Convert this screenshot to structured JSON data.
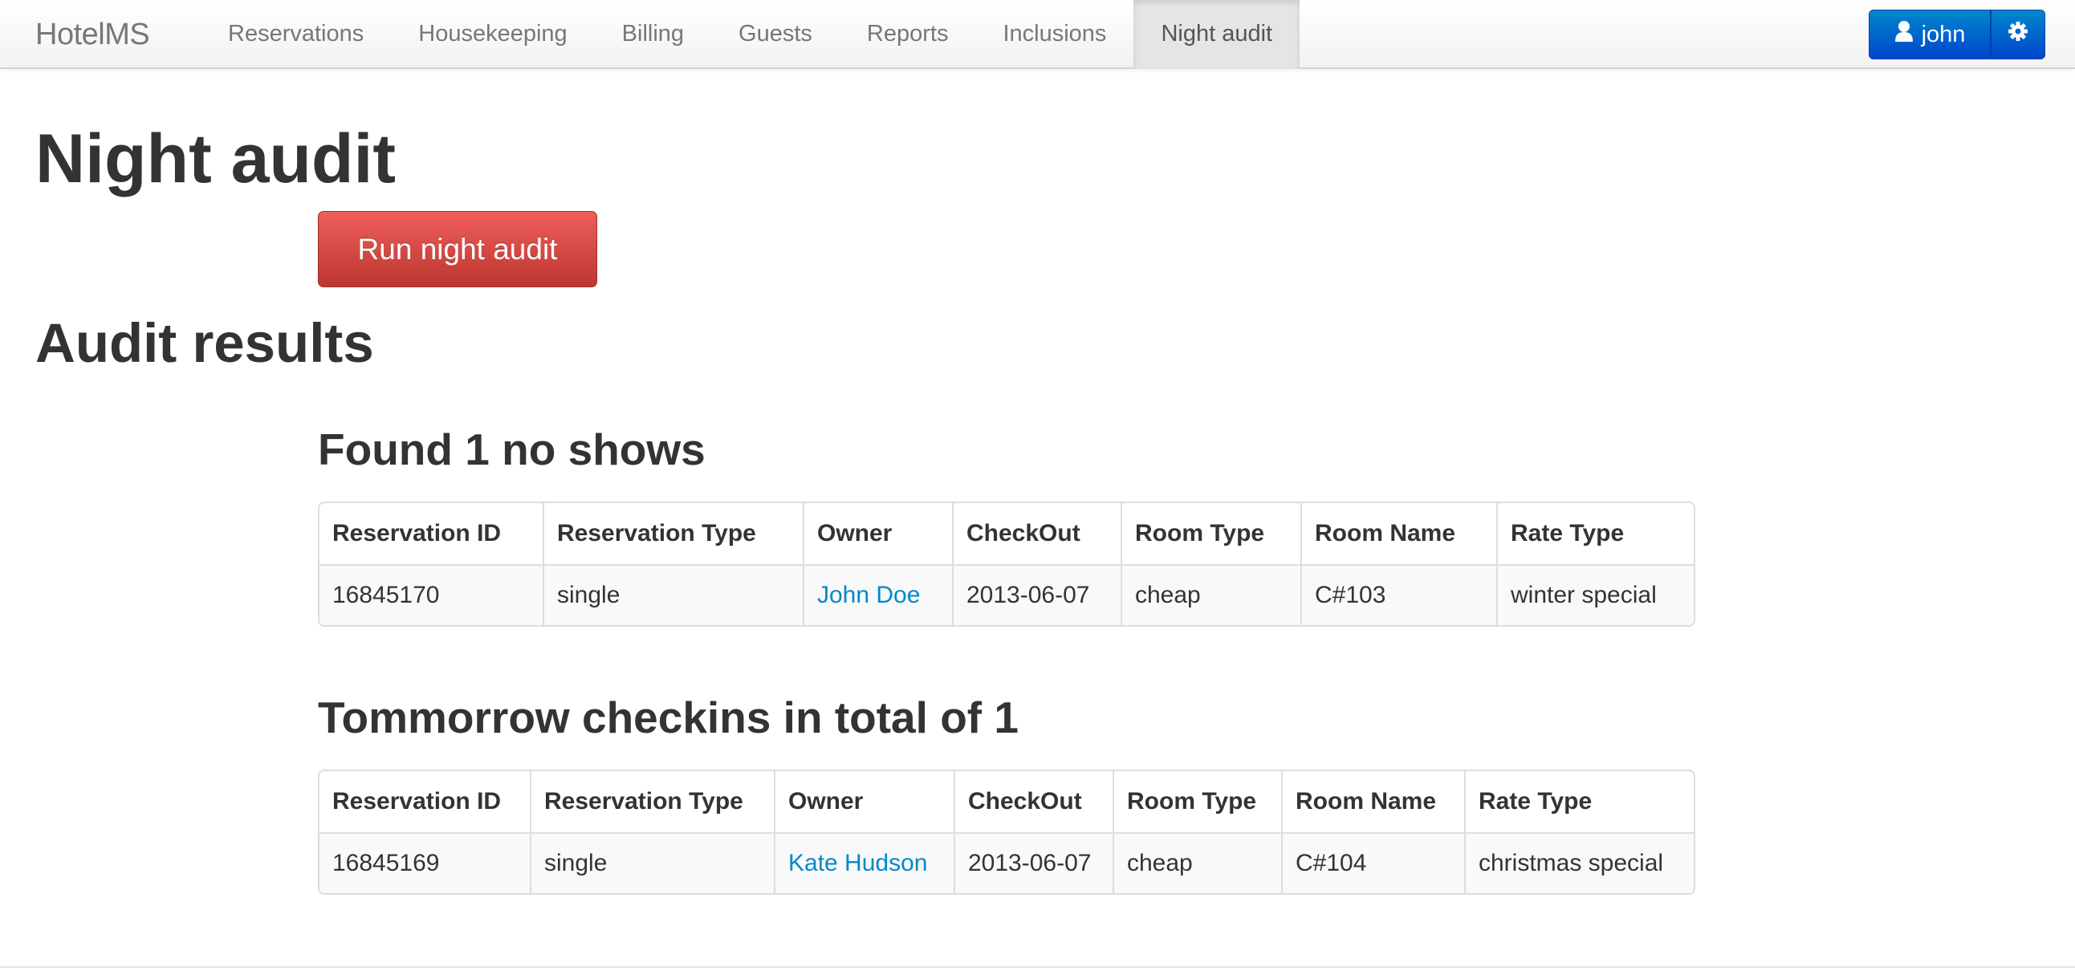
{
  "navbar": {
    "brand": "HotelMS",
    "items": [
      {
        "label": "Reservations"
      },
      {
        "label": "Housekeeping"
      },
      {
        "label": "Billing"
      },
      {
        "label": "Guests"
      },
      {
        "label": "Reports"
      },
      {
        "label": "Inclusions"
      },
      {
        "label": "Night audit",
        "active": true
      }
    ],
    "user": {
      "name": "john",
      "icon": "user-icon",
      "settings_icon": "gear-icon"
    }
  },
  "page": {
    "title": "Night audit",
    "run_button": "Run night audit",
    "results_title": "Audit results"
  },
  "no_shows": {
    "title": "Found 1 no shows",
    "columns": [
      "Reservation ID",
      "Reservation Type",
      "Owner",
      "CheckOut",
      "Room Type",
      "Room Name",
      "Rate Type"
    ],
    "rows": [
      [
        "16845170",
        "single",
        "John Doe",
        "2013-06-07",
        "cheap",
        "C#103",
        "winter special"
      ]
    ]
  },
  "checkins": {
    "title": "Tommorrow checkins in total of 1",
    "columns": [
      "Reservation ID",
      "Reservation Type",
      "Owner",
      "CheckOut",
      "Room Type",
      "Room Name",
      "Rate Type"
    ],
    "rows": [
      [
        "16845169",
        "single",
        "Kate Hudson",
        "2013-06-07",
        "cheap",
        "C#104",
        "christmas special"
      ]
    ]
  },
  "colors": {
    "accent": "#0088cc",
    "danger": "#da4f49",
    "primary": "#0055cc"
  }
}
